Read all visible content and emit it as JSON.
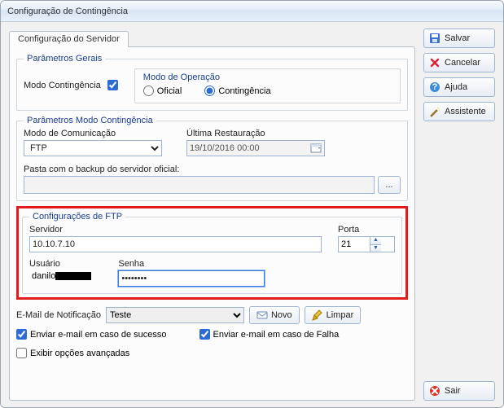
{
  "window": {
    "title": "Configuração de Contingência"
  },
  "tabs": {
    "server": "Configuração do Servidor"
  },
  "general": {
    "legend": "Parâmetros Gerais",
    "modo_label": "Modo Contingência",
    "modo_checked": true,
    "opmode": {
      "legend": "Modo de Operação",
      "oficial": "Oficial",
      "contingencia": "Contingência",
      "selected": "contingencia"
    }
  },
  "contmode": {
    "legend": "Parâmetros Modo Contingência",
    "comm_label": "Modo de Comunicação",
    "comm_value": "FTP",
    "restore_label": "Última Restauração",
    "restore_value": "19/10/2016 00:00",
    "pasta_label": "Pasta com o backup do servidor oficial:",
    "pasta_value": "",
    "browse_label": "..."
  },
  "ftp": {
    "legend": "Configurações de FTP",
    "server_label": "Servidor",
    "server_value": "10.10.7.10",
    "port_label": "Porta",
    "port_value": "21",
    "user_label": "Usuário",
    "user_value": "danilo",
    "pass_label": "Senha",
    "pass_value": "••••••••"
  },
  "email": {
    "label": "E-Mail de Notificação",
    "combo_value": "Teste",
    "novo": "Novo",
    "limpar": "Limpar",
    "sucesso_label": "Enviar e-mail em caso de sucesso",
    "sucesso_checked": true,
    "falha_label": "Enviar e-mail em caso de Falha",
    "falha_checked": true,
    "avancadas_label": "Exibir opções avançadas",
    "avancadas_checked": false
  },
  "buttons": {
    "salvar": "Salvar",
    "cancelar": "Cancelar",
    "ajuda": "Ajuda",
    "assistente": "Assistente",
    "sair": "Sair"
  }
}
